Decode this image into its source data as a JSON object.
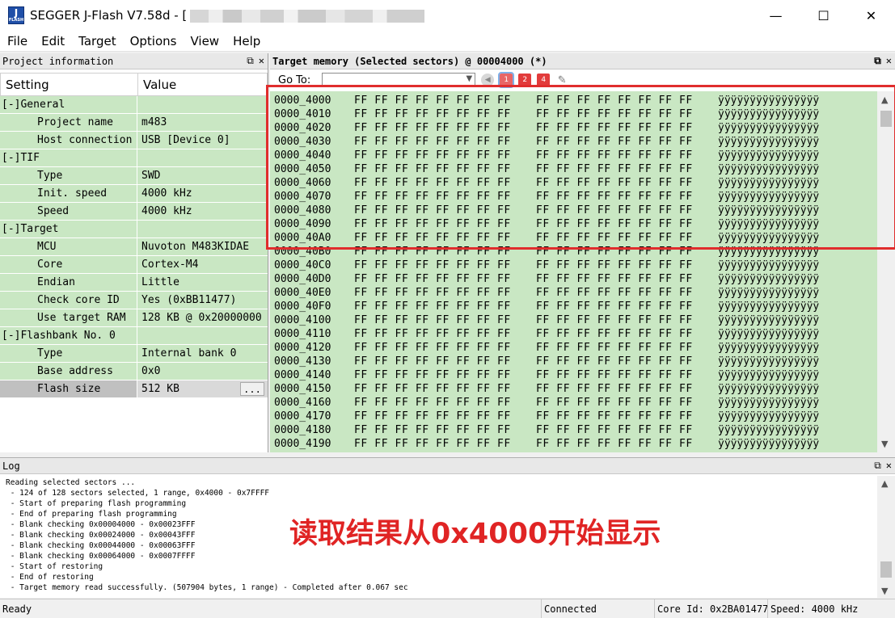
{
  "window": {
    "title": "SEGGER J-Flash V7.58d - [",
    "icon_label_top": "J",
    "icon_label_bottom": "FLASH",
    "controls": [
      "—",
      "☐",
      "✕"
    ]
  },
  "menu": [
    "File",
    "Edit",
    "Target",
    "Options",
    "View",
    "Help"
  ],
  "project_panel": {
    "title": "Project information",
    "col_setting": "Setting",
    "col_value": "Value",
    "rows": [
      {
        "key": "[-]General",
        "value": "",
        "type": "group"
      },
      {
        "key": "Project name",
        "value": "m483",
        "type": "item"
      },
      {
        "key": "Host connection",
        "value": "USB [Device 0]",
        "type": "item"
      },
      {
        "key": "[-]TIF",
        "value": "",
        "type": "group"
      },
      {
        "key": "Type",
        "value": "SWD",
        "type": "item"
      },
      {
        "key": "Init. speed",
        "value": "4000 kHz",
        "type": "item"
      },
      {
        "key": "Speed",
        "value": "4000 kHz",
        "type": "item"
      },
      {
        "key": "[-]Target",
        "value": "",
        "type": "group"
      },
      {
        "key": "MCU",
        "value": "Nuvoton M483KIDAE",
        "type": "item"
      },
      {
        "key": "Core",
        "value": "Cortex-M4",
        "type": "item"
      },
      {
        "key": "Endian",
        "value": "Little",
        "type": "item"
      },
      {
        "key": "Check core ID",
        "value": "Yes (0xBB11477)",
        "type": "item"
      },
      {
        "key": "Use target RAM",
        "value": "128 KB @ 0x20000000",
        "type": "item"
      },
      {
        "key": "[-]Flashbank No. 0",
        "value": "",
        "type": "group"
      },
      {
        "key": "Type",
        "value": "Internal bank 0",
        "type": "item"
      },
      {
        "key": "Base address",
        "value": "0x0",
        "type": "item"
      },
      {
        "key": "Flash size",
        "value": "512 KB",
        "type": "item",
        "selected": true,
        "button": "..."
      }
    ]
  },
  "memory_panel": {
    "title": "Target memory (Selected sectors) @ 00004000 (*)",
    "goto_label": "Go To:",
    "goto_value": "",
    "rows": [
      {
        "addr": "0000_4000",
        "bytes1": "FF FF FF FF FF FF FF FF",
        "bytes2": "FF FF FF FF FF FF FF FF",
        "ascii": "ÿÿÿÿÿÿÿÿÿÿÿÿÿÿÿÿ"
      },
      {
        "addr": "0000_4010",
        "bytes1": "FF FF FF FF FF FF FF FF",
        "bytes2": "FF FF FF FF FF FF FF FF",
        "ascii": "ÿÿÿÿÿÿÿÿÿÿÿÿÿÿÿÿ"
      },
      {
        "addr": "0000_4020",
        "bytes1": "FF FF FF FF FF FF FF FF",
        "bytes2": "FF FF FF FF FF FF FF FF",
        "ascii": "ÿÿÿÿÿÿÿÿÿÿÿÿÿÿÿÿ"
      },
      {
        "addr": "0000_4030",
        "bytes1": "FF FF FF FF FF FF FF FF",
        "bytes2": "FF FF FF FF FF FF FF FF",
        "ascii": "ÿÿÿÿÿÿÿÿÿÿÿÿÿÿÿÿ"
      },
      {
        "addr": "0000_4040",
        "bytes1": "FF FF FF FF FF FF FF FF",
        "bytes2": "FF FF FF FF FF FF FF FF",
        "ascii": "ÿÿÿÿÿÿÿÿÿÿÿÿÿÿÿÿ"
      },
      {
        "addr": "0000_4050",
        "bytes1": "FF FF FF FF FF FF FF FF",
        "bytes2": "FF FF FF FF FF FF FF FF",
        "ascii": "ÿÿÿÿÿÿÿÿÿÿÿÿÿÿÿÿ"
      },
      {
        "addr": "0000_4060",
        "bytes1": "FF FF FF FF FF FF FF FF",
        "bytes2": "FF FF FF FF FF FF FF FF",
        "ascii": "ÿÿÿÿÿÿÿÿÿÿÿÿÿÿÿÿ"
      },
      {
        "addr": "0000_4070",
        "bytes1": "FF FF FF FF FF FF FF FF",
        "bytes2": "FF FF FF FF FF FF FF FF",
        "ascii": "ÿÿÿÿÿÿÿÿÿÿÿÿÿÿÿÿ"
      },
      {
        "addr": "0000_4080",
        "bytes1": "FF FF FF FF FF FF FF FF",
        "bytes2": "FF FF FF FF FF FF FF FF",
        "ascii": "ÿÿÿÿÿÿÿÿÿÿÿÿÿÿÿÿ"
      },
      {
        "addr": "0000_4090",
        "bytes1": "FF FF FF FF FF FF FF FF",
        "bytes2": "FF FF FF FF FF FF FF FF",
        "ascii": "ÿÿÿÿÿÿÿÿÿÿÿÿÿÿÿÿ"
      },
      {
        "addr": "0000_40A0",
        "bytes1": "FF FF FF FF FF FF FF FF",
        "bytes2": "FF FF FF FF FF FF FF FF",
        "ascii": "ÿÿÿÿÿÿÿÿÿÿÿÿÿÿÿÿ"
      },
      {
        "addr": "0000_40B0",
        "bytes1": "FF FF FF FF FF FF FF FF",
        "bytes2": "FF FF FF FF FF FF FF FF",
        "ascii": "ÿÿÿÿÿÿÿÿÿÿÿÿÿÿÿÿ"
      },
      {
        "addr": "0000_40C0",
        "bytes1": "FF FF FF FF FF FF FF FF",
        "bytes2": "FF FF FF FF FF FF FF FF",
        "ascii": "ÿÿÿÿÿÿÿÿÿÿÿÿÿÿÿÿ"
      },
      {
        "addr": "0000_40D0",
        "bytes1": "FF FF FF FF FF FF FF FF",
        "bytes2": "FF FF FF FF FF FF FF FF",
        "ascii": "ÿÿÿÿÿÿÿÿÿÿÿÿÿÿÿÿ"
      },
      {
        "addr": "0000_40E0",
        "bytes1": "FF FF FF FF FF FF FF FF",
        "bytes2": "FF FF FF FF FF FF FF FF",
        "ascii": "ÿÿÿÿÿÿÿÿÿÿÿÿÿÿÿÿ"
      },
      {
        "addr": "0000_40F0",
        "bytes1": "FF FF FF FF FF FF FF FF",
        "bytes2": "FF FF FF FF FF FF FF FF",
        "ascii": "ÿÿÿÿÿÿÿÿÿÿÿÿÿÿÿÿ"
      },
      {
        "addr": "0000_4100",
        "bytes1": "FF FF FF FF FF FF FF FF",
        "bytes2": "FF FF FF FF FF FF FF FF",
        "ascii": "ÿÿÿÿÿÿÿÿÿÿÿÿÿÿÿÿ"
      },
      {
        "addr": "0000_4110",
        "bytes1": "FF FF FF FF FF FF FF FF",
        "bytes2": "FF FF FF FF FF FF FF FF",
        "ascii": "ÿÿÿÿÿÿÿÿÿÿÿÿÿÿÿÿ"
      },
      {
        "addr": "0000_4120",
        "bytes1": "FF FF FF FF FF FF FF FF",
        "bytes2": "FF FF FF FF FF FF FF FF",
        "ascii": "ÿÿÿÿÿÿÿÿÿÿÿÿÿÿÿÿ"
      },
      {
        "addr": "0000_4130",
        "bytes1": "FF FF FF FF FF FF FF FF",
        "bytes2": "FF FF FF FF FF FF FF FF",
        "ascii": "ÿÿÿÿÿÿÿÿÿÿÿÿÿÿÿÿ"
      },
      {
        "addr": "0000_4140",
        "bytes1": "FF FF FF FF FF FF FF FF",
        "bytes2": "FF FF FF FF FF FF FF FF",
        "ascii": "ÿÿÿÿÿÿÿÿÿÿÿÿÿÿÿÿ"
      },
      {
        "addr": "0000_4150",
        "bytes1": "FF FF FF FF FF FF FF FF",
        "bytes2": "FF FF FF FF FF FF FF FF",
        "ascii": "ÿÿÿÿÿÿÿÿÿÿÿÿÿÿÿÿ"
      },
      {
        "addr": "0000_4160",
        "bytes1": "FF FF FF FF FF FF FF FF",
        "bytes2": "FF FF FF FF FF FF FF FF",
        "ascii": "ÿÿÿÿÿÿÿÿÿÿÿÿÿÿÿÿ"
      },
      {
        "addr": "0000_4170",
        "bytes1": "FF FF FF FF FF FF FF FF",
        "bytes2": "FF FF FF FF FF FF FF FF",
        "ascii": "ÿÿÿÿÿÿÿÿÿÿÿÿÿÿÿÿ"
      },
      {
        "addr": "0000_4180",
        "bytes1": "FF FF FF FF FF FF FF FF",
        "bytes2": "FF FF FF FF FF FF FF FF",
        "ascii": "ÿÿÿÿÿÿÿÿÿÿÿÿÿÿÿÿ"
      },
      {
        "addr": "0000_4190",
        "bytes1": "FF FF FF FF FF FF FF FF",
        "bytes2": "FF FF FF FF FF FF FF FF",
        "ascii": "ÿÿÿÿÿÿÿÿÿÿÿÿÿÿÿÿ"
      }
    ]
  },
  "log_panel": {
    "title": "Log",
    "lines": [
      "Reading selected sectors ...",
      " - 124 of 128 sectors selected, 1 range, 0x4000 - 0x7FFFF",
      " - Start of preparing flash programming",
      " - End of preparing flash programming",
      " - Blank checking 0x00004000 - 0x00023FFF",
      " - Blank checking 0x00024000 - 0x00043FFF",
      " - Blank checking 0x00044000 - 0x00063FFF",
      " - Blank checking 0x00064000 - 0x0007FFFF",
      " - Start of restoring",
      " - End of restoring",
      " - Target memory read successfully. (507904 bytes, 1 range) - Completed after 0.067 sec"
    ]
  },
  "annotation": "读取结果从0x4000开始显示",
  "status_bar": {
    "ready": "Ready",
    "connection": "Connected",
    "core_id": "Core Id: 0x2BA01477",
    "speed": "Speed: 4000 kHz"
  },
  "colors": {
    "grid_bg": "#c9e7c3",
    "annotation": "#e02424",
    "highlight_box": "#e02d2d"
  }
}
